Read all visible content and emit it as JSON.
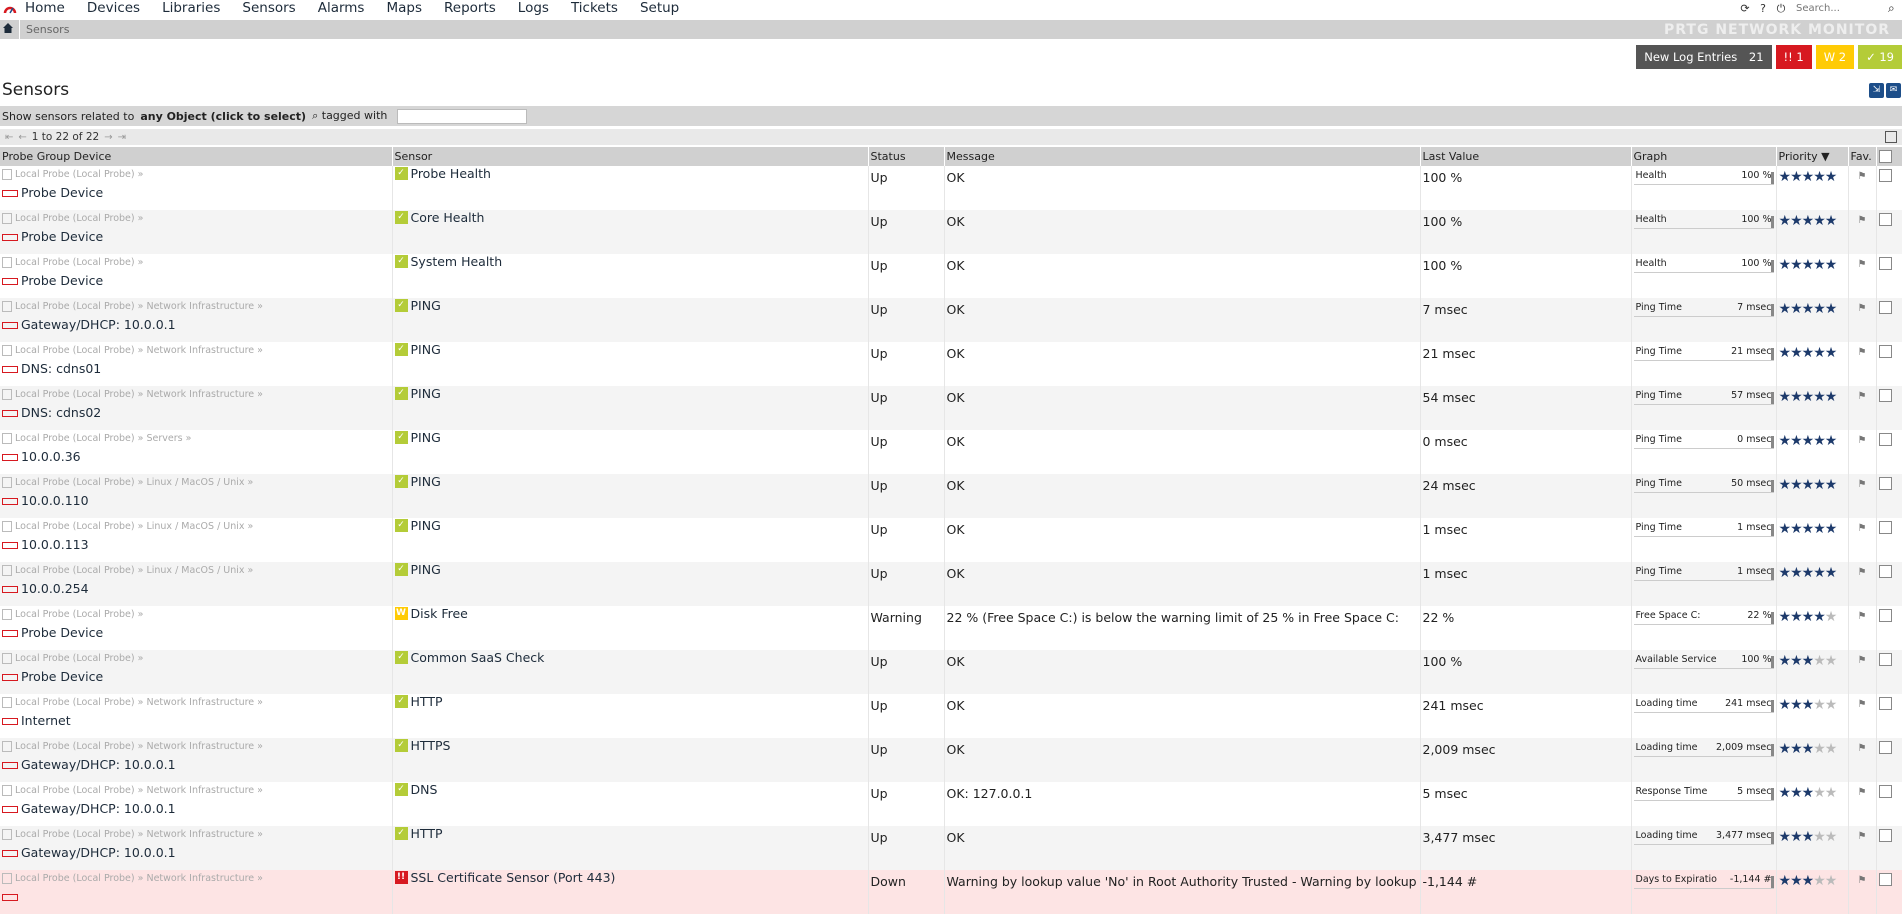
{
  "nav": {
    "items": [
      "Home",
      "Devices",
      "Libraries",
      "Sensors",
      "Alarms",
      "Maps",
      "Reports",
      "Logs",
      "Tickets",
      "Setup"
    ],
    "search_placeholder": "Search...",
    "right_icons": [
      "refresh-icon",
      "help-icon",
      "logout-icon"
    ]
  },
  "breadcrumb": {
    "current": "Sensors"
  },
  "brand": "PRTG NETWORK MONITOR",
  "alerts": {
    "log_label": "New Log Entries",
    "log_count": "21",
    "down_label": "!! 1",
    "warn_label": "W 2",
    "up_label": "✓ 19",
    "colors": {
      "down": "#d71920",
      "warn": "#ffcb05",
      "up": "#b4cc38",
      "log": "#555555"
    }
  },
  "page_title": "Sensors",
  "filter": {
    "prefix": "Show sensors related to",
    "object": "any Object (click to select)",
    "tagged": "tagged with",
    "tag_value": ""
  },
  "pager": {
    "text": "1 to 22 of 22"
  },
  "columns": {
    "group_device": "Probe Group Device",
    "sensor": "Sensor",
    "status": "Status",
    "message": "Message",
    "last_value": "Last Value",
    "graph": "Graph",
    "priority": "Priority",
    "fav": "Fav."
  },
  "rows": [
    {
      "path": "Local Probe (Local Probe) »",
      "device": "Probe Device",
      "status_type": "up",
      "sensor": "Probe Health",
      "status": "Up",
      "message": "OK",
      "last_value": "100 %",
      "graph_label": "Health",
      "graph_value": "100 %",
      "priority": 5
    },
    {
      "path": "Local Probe (Local Probe) »",
      "device": "Probe Device",
      "status_type": "up",
      "sensor": "Core Health",
      "status": "Up",
      "message": "OK",
      "last_value": "100 %",
      "graph_label": "Health",
      "graph_value": "100 %",
      "priority": 5
    },
    {
      "path": "Local Probe (Local Probe) »",
      "device": "Probe Device",
      "status_type": "up",
      "sensor": "System Health",
      "status": "Up",
      "message": "OK",
      "last_value": "100 %",
      "graph_label": "Health",
      "graph_value": "100 %",
      "priority": 5
    },
    {
      "path": "Local Probe (Local Probe) » Network Infrastructure »",
      "device": "Gateway/DHCP: 10.0.0.1",
      "status_type": "up",
      "sensor": "PING",
      "status": "Up",
      "message": "OK",
      "last_value": "7 msec",
      "graph_label": "Ping Time",
      "graph_value": "7 msec",
      "priority": 5
    },
    {
      "path": "Local Probe (Local Probe) » Network Infrastructure »",
      "device": "DNS: cdns01",
      "status_type": "up",
      "sensor": "PING",
      "status": "Up",
      "message": "OK",
      "last_value": "21 msec",
      "graph_label": "Ping Time",
      "graph_value": "21 msec",
      "priority": 5
    },
    {
      "path": "Local Probe (Local Probe) » Network Infrastructure »",
      "device": "DNS: cdns02",
      "status_type": "up",
      "sensor": "PING",
      "status": "Up",
      "message": "OK",
      "last_value": "54 msec",
      "graph_label": "Ping Time",
      "graph_value": "57 msec",
      "priority": 5
    },
    {
      "path": "Local Probe (Local Probe) » Servers »",
      "device": "10.0.0.36",
      "status_type": "up",
      "sensor": "PING",
      "status": "Up",
      "message": "OK",
      "last_value": "0 msec",
      "graph_label": "Ping Time",
      "graph_value": "0 msec",
      "priority": 5
    },
    {
      "path": "Local Probe (Local Probe) » Linux / MacOS / Unix »",
      "device": "10.0.0.110",
      "status_type": "up",
      "sensor": "PING",
      "status": "Up",
      "message": "OK",
      "last_value": "24 msec",
      "graph_label": "Ping Time",
      "graph_value": "50 msec",
      "priority": 5
    },
    {
      "path": "Local Probe (Local Probe) » Linux / MacOS / Unix »",
      "device": "10.0.0.113",
      "status_type": "up",
      "sensor": "PING",
      "status": "Up",
      "message": "OK",
      "last_value": "1 msec",
      "graph_label": "Ping Time",
      "graph_value": "1 msec",
      "priority": 5
    },
    {
      "path": "Local Probe (Local Probe) » Linux / MacOS / Unix »",
      "device": "10.0.0.254",
      "status_type": "up",
      "sensor": "PING",
      "status": "Up",
      "message": "OK",
      "last_value": "1 msec",
      "graph_label": "Ping Time",
      "graph_value": "1 msec",
      "priority": 5
    },
    {
      "path": "Local Probe (Local Probe) »",
      "device": "Probe Device",
      "status_type": "warn",
      "sensor": "Disk Free",
      "status": "Warning",
      "message": "22 % (Free Space C:) is below the warning limit of 25 % in Free Space C:",
      "last_value": "22 %",
      "graph_label": "Free Space C:",
      "graph_value": "22 %",
      "priority": 4
    },
    {
      "path": "Local Probe (Local Probe) »",
      "device": "Probe Device",
      "status_type": "up",
      "sensor": "Common SaaS Check",
      "status": "Up",
      "message": "OK",
      "last_value": "100 %",
      "graph_label": "Available Service",
      "graph_value": "100 %",
      "priority": 3
    },
    {
      "path": "Local Probe (Local Probe) » Network Infrastructure »",
      "device": "Internet",
      "status_type": "up",
      "sensor": "HTTP",
      "status": "Up",
      "message": "OK",
      "last_value": "241 msec",
      "graph_label": "Loading time",
      "graph_value": "241 msec",
      "priority": 3
    },
    {
      "path": "Local Probe (Local Probe) » Network Infrastructure »",
      "device": "Gateway/DHCP: 10.0.0.1",
      "status_type": "up",
      "sensor": "HTTPS",
      "status": "Up",
      "message": "OK",
      "last_value": "2,009 msec",
      "graph_label": "Loading time",
      "graph_value": "2,009 msec",
      "priority": 3
    },
    {
      "path": "Local Probe (Local Probe) » Network Infrastructure »",
      "device": "Gateway/DHCP: 10.0.0.1",
      "status_type": "up",
      "sensor": "DNS",
      "status": "Up",
      "message": "OK: 127.0.0.1",
      "last_value": "5 msec",
      "graph_label": "Response Time",
      "graph_value": "5 msec",
      "priority": 3
    },
    {
      "path": "Local Probe (Local Probe) » Network Infrastructure »",
      "device": "Gateway/DHCP: 10.0.0.1",
      "status_type": "up",
      "sensor": "HTTP",
      "status": "Up",
      "message": "OK",
      "last_value": "3,477 msec",
      "graph_label": "Loading time",
      "graph_value": "3,477 msec",
      "priority": 3
    },
    {
      "path": "Local Probe (Local Probe) » Network Infrastructure »",
      "device": "",
      "status_type": "down",
      "sensor": "SSL Certificate Sensor (Port 443)",
      "status": "Down",
      "message": "Warning by lookup value 'No' in Root Authority Trusted - Warning by lookup value",
      "last_value": "-1,144 #",
      "graph_label": "Days to Expiratio",
      "graph_value": "-1,144 #",
      "priority": 3
    }
  ]
}
